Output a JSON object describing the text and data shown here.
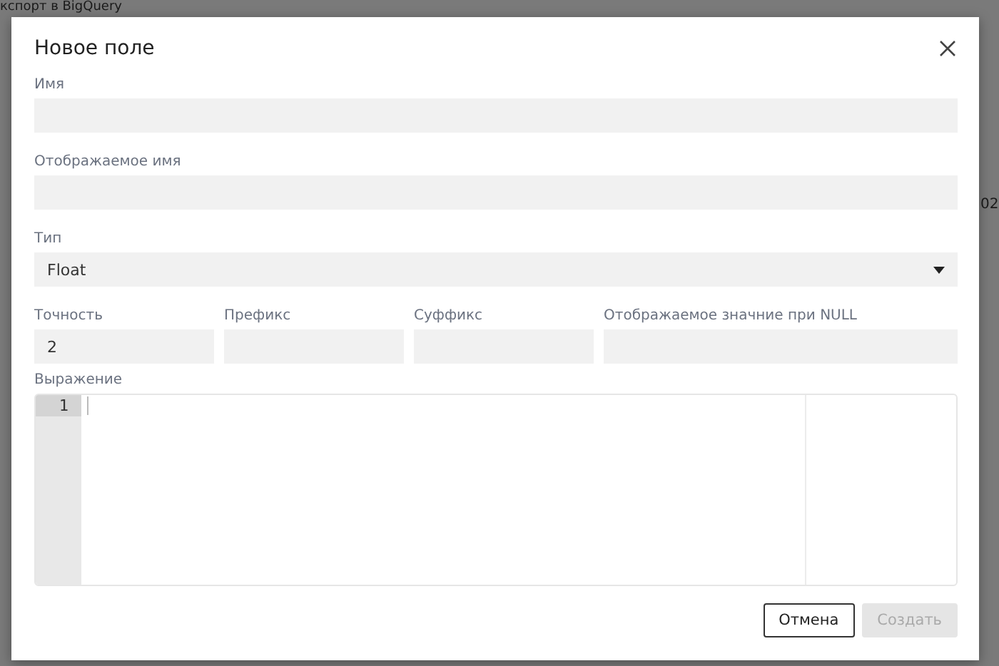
{
  "background": {
    "title": "кспорт в BigQuery",
    "fragment": "02"
  },
  "dialog": {
    "title": "Новое поле"
  },
  "fields": [
    {
      "kind": "text",
      "label": "Имя"
    },
    {
      "kind": "text",
      "label": "Отображаемое имя"
    },
    {
      "kind": "select",
      "label": "Тип",
      "value": "Float"
    }
  ],
  "format_fields": [
    {
      "label": "Точность",
      "value": "2"
    },
    {
      "label": "Префикс"
    },
    {
      "label": "Суффикс"
    },
    {
      "label": "Отображаемое значние при NULL"
    }
  ],
  "expression": {
    "label": "Выражение",
    "line_numbers": [
      "1"
    ]
  },
  "buttons": [
    {
      "label": "Отмена",
      "disabled": false
    },
    {
      "label": "Создать",
      "disabled": true
    }
  ]
}
